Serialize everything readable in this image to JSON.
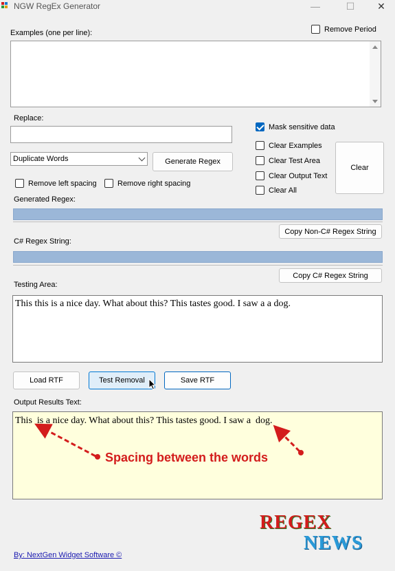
{
  "window": {
    "title": "NGW RegEx Generator",
    "minimize_glyph": "—",
    "maximize_glyph": "☐",
    "close_glyph": "✕"
  },
  "examples": {
    "label": "Examples (one per line):",
    "value": ""
  },
  "remove_period": {
    "label": "Remove Period",
    "checked": false
  },
  "replace": {
    "label": "Replace:",
    "value": ""
  },
  "mask_sensitive": {
    "label": "Mask sensitive data",
    "checked": true
  },
  "clear_options": {
    "clear_examples": "Clear Examples",
    "clear_test_area": "Clear Test Area",
    "clear_output_text": "Clear Output Text",
    "clear_all": "Clear All"
  },
  "clear_button": "Clear",
  "pattern_select": {
    "selected": "Duplicate Words"
  },
  "generate_button": "Generate Regex",
  "remove_left_spacing": "Remove left spacing",
  "remove_right_spacing": "Remove right spacing",
  "generated_regex": {
    "label": "Generated Regex:"
  },
  "copy_non_csharp": "Copy Non-C# Regex String",
  "csharp_regex": {
    "label": "C# Regex String:"
  },
  "copy_csharp": "Copy C# Regex String",
  "testing_area": {
    "label": "Testing Area:",
    "text": "This this is a nice day. What about this? This tastes good. I saw a a dog."
  },
  "buttons": {
    "load_rtf": "Load RTF",
    "test_removal": "Test Removal",
    "save_rtf": "Save RTF"
  },
  "output": {
    "label": "Output Results Text:",
    "text": "This  is a nice day. What about this? This tastes good. I saw a  dog."
  },
  "annotation": {
    "text": "Spacing between the words",
    "color": "#d31c1c"
  },
  "logo": {
    "line1": "REGEX",
    "line2": "NEWS"
  },
  "footer": {
    "link": "By: NextGen Widget Software  ©"
  },
  "colors": {
    "window_bg": "#f0f0f0",
    "output_bg": "#ffffdd",
    "progress": "#9bb7d8",
    "accent": "#0067c0"
  }
}
